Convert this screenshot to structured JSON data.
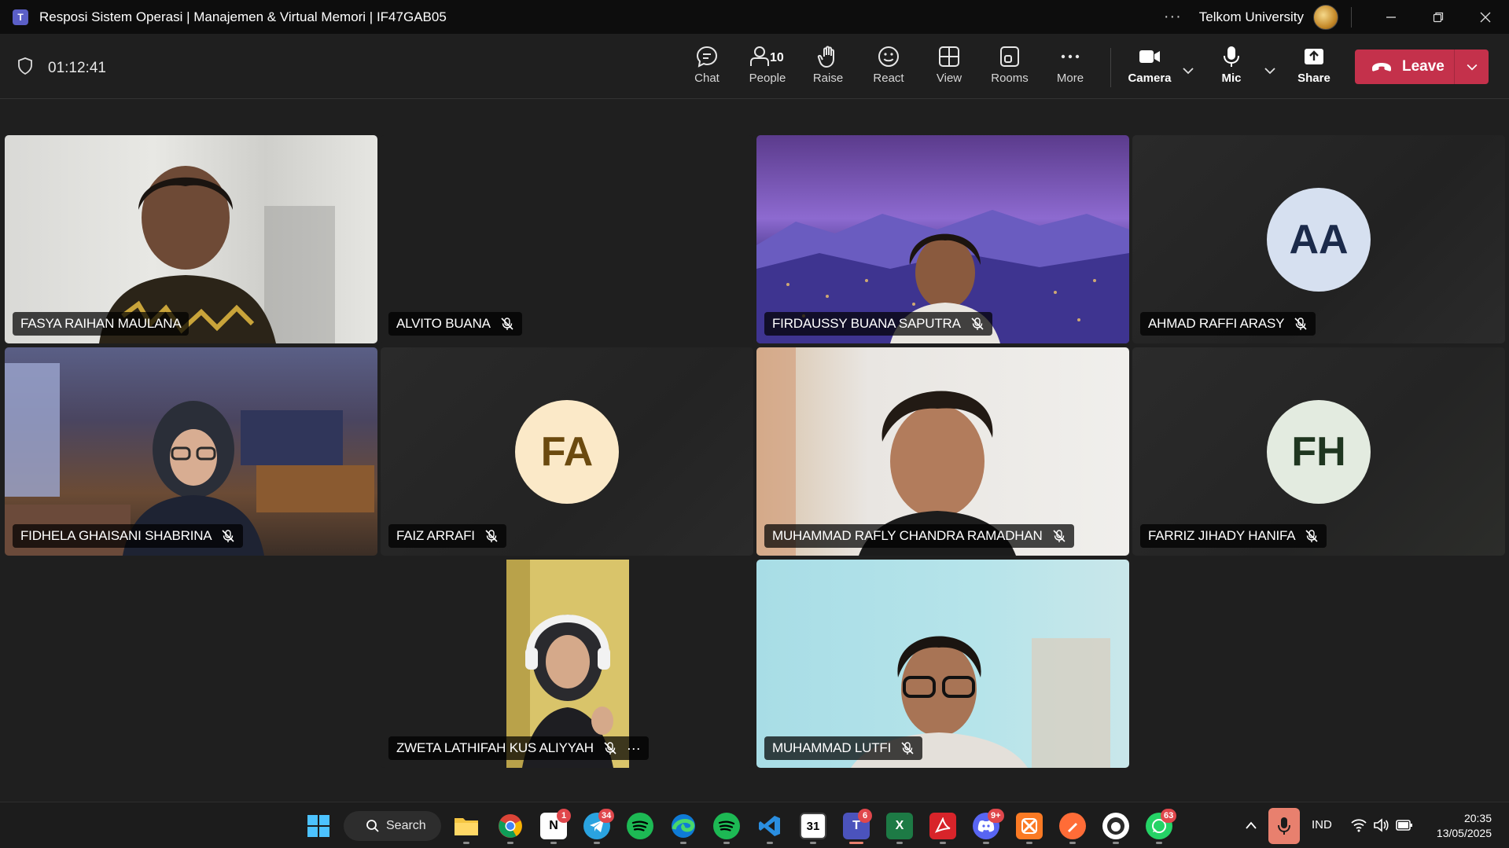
{
  "window": {
    "title": "Resposi Sistem Operasi | Manajemen & Virtual Memori | IF47GAB05",
    "app_icon": "teams-icon",
    "org_name": "Telkom University",
    "more_label": "···"
  },
  "meeting": {
    "timer": "01:12:41",
    "tools": [
      {
        "label": "Chat",
        "icon": "chat-icon"
      },
      {
        "label": "People",
        "icon": "people-icon",
        "count": "10"
      },
      {
        "label": "Raise",
        "icon": "hand-icon"
      },
      {
        "label": "React",
        "icon": "smile-icon"
      },
      {
        "label": "View",
        "icon": "grid-icon"
      },
      {
        "label": "Rooms",
        "icon": "rooms-icon"
      },
      {
        "label": "More",
        "icon": "more-icon"
      },
      {
        "label": "Camera",
        "icon": "camera-icon"
      },
      {
        "label": "Mic",
        "icon": "mic-icon"
      },
      {
        "label": "Share",
        "icon": "share-icon"
      }
    ],
    "leave_label": "Leave",
    "leave_color": "#c4314b"
  },
  "participants": [
    {
      "name": "FASYA RAIHAN MAULANA",
      "muted": false,
      "video": true
    },
    {
      "name": "ALVITO BUANA",
      "muted": true,
      "video": false
    },
    {
      "name": "FIRDAUSSY BUANA SAPUTRA",
      "muted": true,
      "video": true
    },
    {
      "name": "AHMAD RAFFI ARASY",
      "muted": true,
      "video": false,
      "initials": "AA",
      "avatar_bg": "#d6e0f0",
      "avatar_fg": "#1b2a4a"
    },
    {
      "name": "FIDHELA GHAISANI SHABRINA",
      "muted": true,
      "video": true
    },
    {
      "name": "FAIZ ARRAFI",
      "muted": true,
      "video": false,
      "initials": "FA",
      "avatar_bg": "#fbe9c8",
      "avatar_fg": "#6b4a0f"
    },
    {
      "name": "MUHAMMAD RAFLY CHANDRA RAMADHAN",
      "muted": true,
      "video": true
    },
    {
      "name": "FARRIZ JIHADY HANIFA",
      "muted": true,
      "video": false,
      "initials": "FH",
      "avatar_bg": "#e3ebe0",
      "avatar_fg": "#1f3620"
    },
    {
      "name": "ZWETA LATHIFAH KUS ALIYYAH",
      "muted": true,
      "video": true,
      "more": "···"
    },
    {
      "name": "MUHAMMAD LUTFI",
      "muted": true,
      "video": true
    }
  ],
  "taskbar": {
    "search_label": "Search",
    "apps": [
      {
        "name": "file-explorer-icon",
        "badge": ""
      },
      {
        "name": "chrome-icon",
        "badge": ""
      },
      {
        "name": "notion-icon",
        "badge": "1"
      },
      {
        "name": "telegram-icon",
        "badge": "34"
      },
      {
        "name": "spotify-icon",
        "badge": ""
      },
      {
        "name": "edge-icon",
        "badge": ""
      },
      {
        "name": "spotify-green-icon",
        "badge": ""
      },
      {
        "name": "vscode-icon",
        "badge": ""
      },
      {
        "name": "calendar-icon",
        "badge": ""
      },
      {
        "name": "teams-icon",
        "badge": "6"
      },
      {
        "name": "excel-icon",
        "badge": ""
      },
      {
        "name": "acrobat-icon",
        "badge": ""
      },
      {
        "name": "discord-icon",
        "badge": "9+"
      },
      {
        "name": "xampp-icon",
        "badge": ""
      },
      {
        "name": "postman-icon",
        "badge": ""
      },
      {
        "name": "github-desktop-icon",
        "badge": ""
      },
      {
        "name": "whatsapp-icon",
        "badge": "63"
      }
    ],
    "notion_glyph": "N",
    "calendar_glyph": "31",
    "excel_glyph": "X",
    "language": "IND",
    "time": "20:35",
    "date": "13/05/2025"
  }
}
